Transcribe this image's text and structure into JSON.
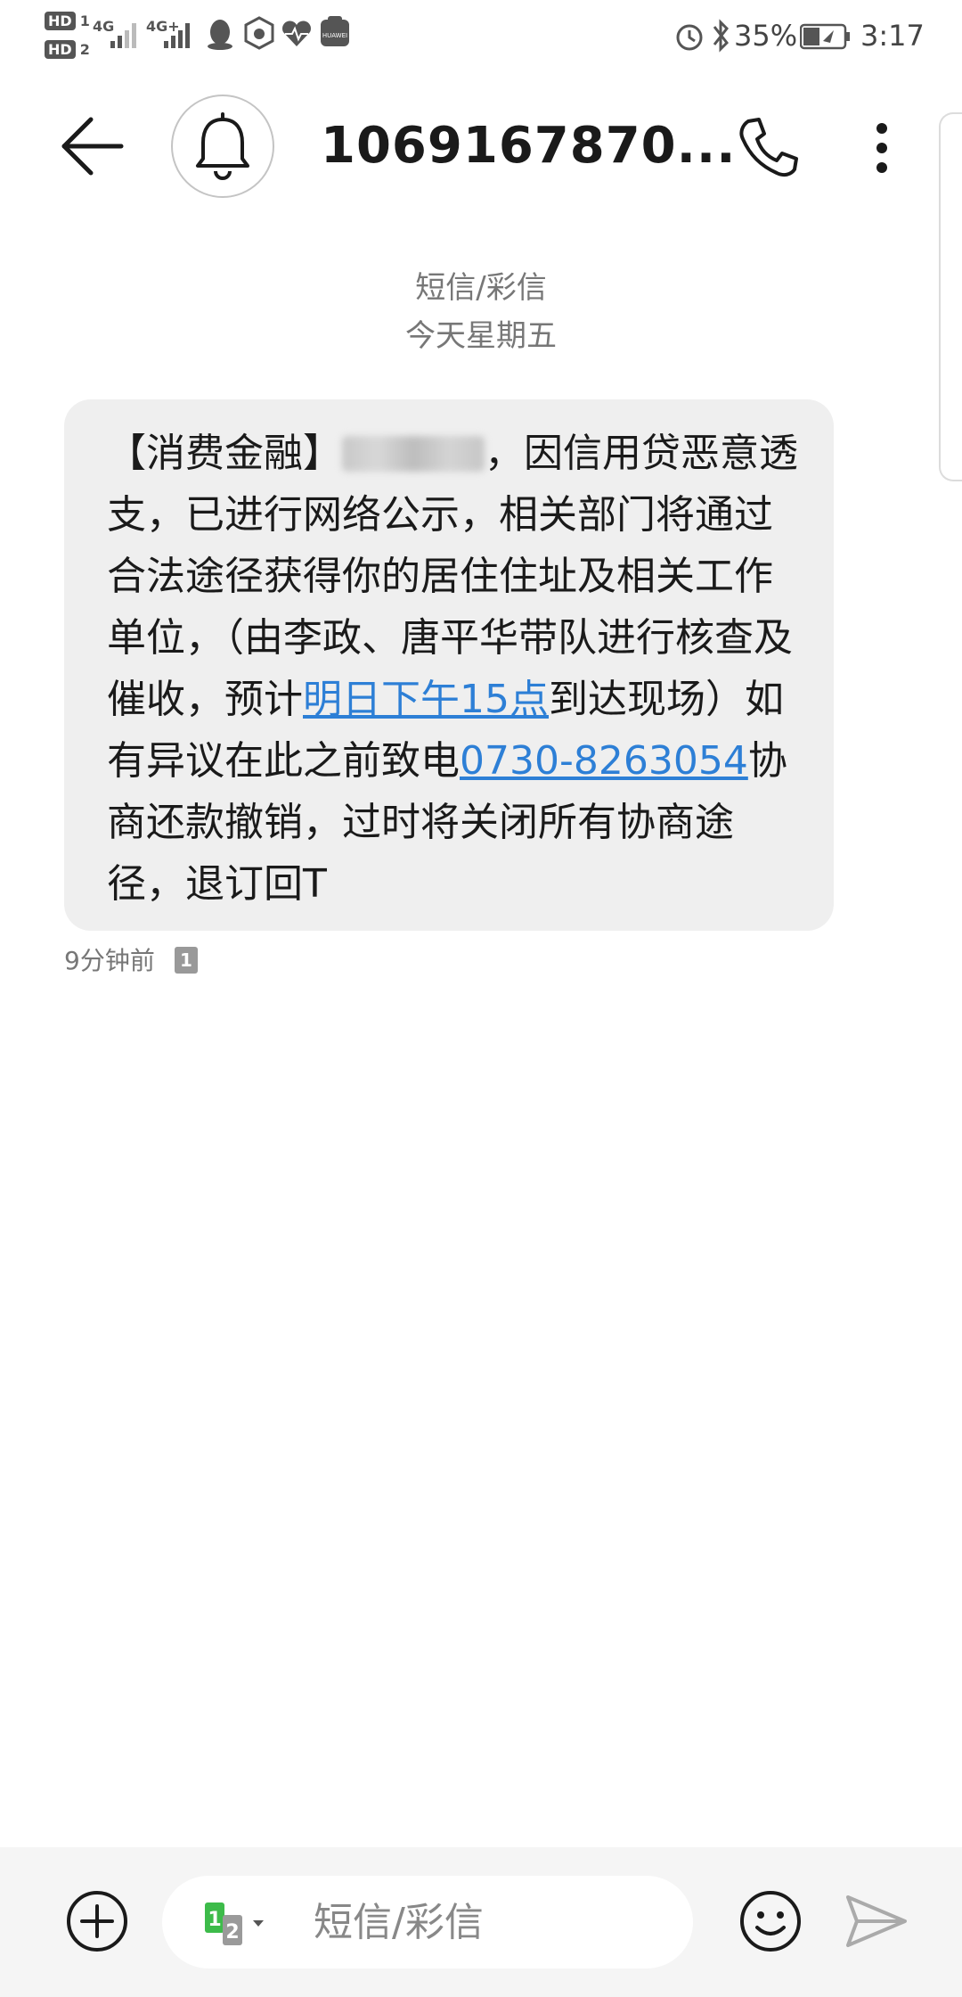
{
  "status_bar": {
    "sim1": "HD",
    "sim1_num": "1",
    "sim2": "HD",
    "sim2_num": "2",
    "net1": "4G",
    "net2": "4G+",
    "battery": "35%",
    "time": "3:17",
    "icons": [
      "qq-icon",
      "hand-icon",
      "heart-rate-icon",
      "huawei-icon",
      "alarm-icon",
      "bluetooth-icon",
      "battery-icon"
    ]
  },
  "header": {
    "title": "1069167870...",
    "icons": [
      "back-arrow-icon",
      "bell-icon",
      "phone-icon",
      "more-vertical-icon"
    ]
  },
  "separator": {
    "type": "短信/彩信",
    "day": "今天星期五"
  },
  "message": {
    "part1": "【消费金融】",
    "part2": "，因信用贷恶意透支，已进行网络公示，相关部门将通过合法途径获得你的居住住址及相关工作单位，（由李政、唐平华带队进行核查及催收，预计",
    "link_time": "明日下午15点",
    "part3": "到达现场）如有异议在此之前致电",
    "link_phone": "0730-8263054",
    "part4": "协商还款撤销，过时将关闭所有协商途径，退订回T",
    "time": "9分钟前",
    "sim_badge": "1"
  },
  "composer": {
    "placeholder": "短信/彩信",
    "sim_selector": [
      "1",
      "2"
    ],
    "icons": [
      "add-icon",
      "sim-select-icon",
      "emoji-icon",
      "send-icon"
    ]
  },
  "colors": {
    "link": "#2d7fd6",
    "bubble": "#efefef",
    "sim1": "#3dbb4a",
    "sim2": "#9a9a9a"
  }
}
